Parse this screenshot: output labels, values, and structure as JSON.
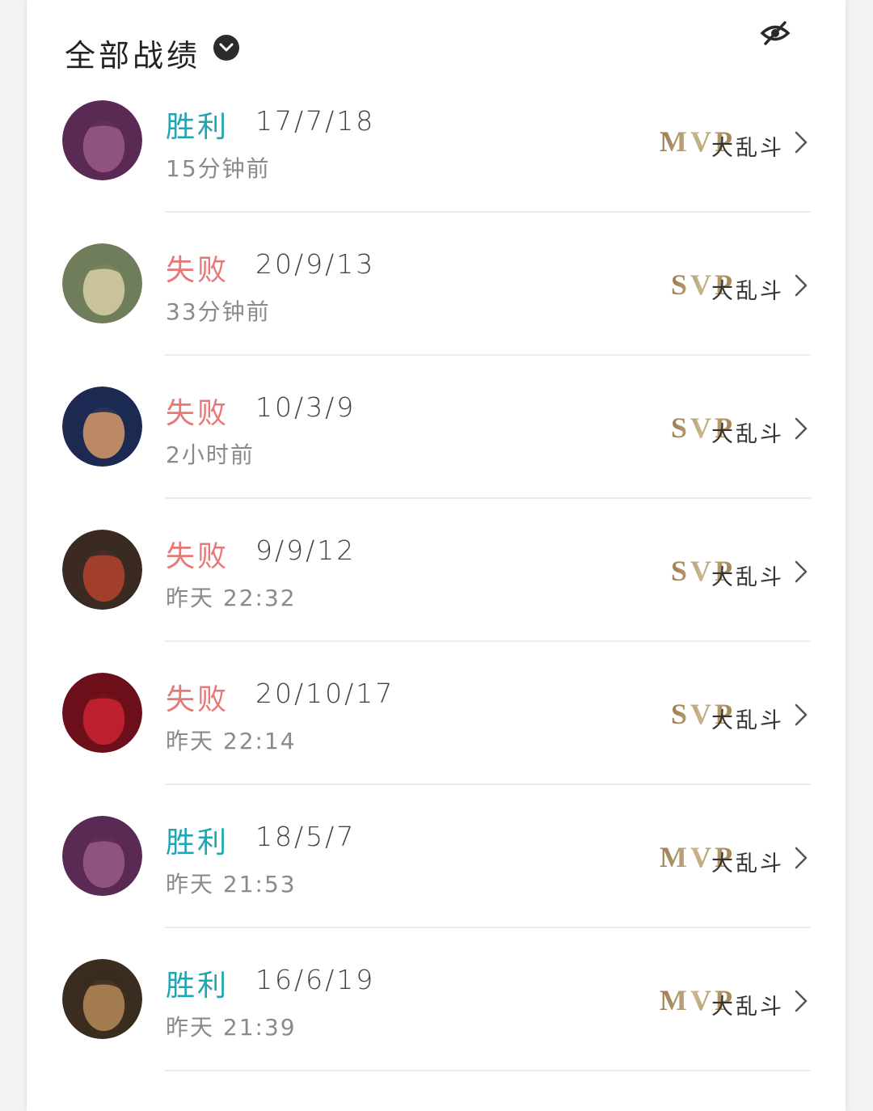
{
  "header": {
    "title": "全部战绩"
  },
  "matches": [
    {
      "result": "胜利",
      "outcome": "win",
      "kda": "17/7/18",
      "time": "15分钟前",
      "badge": "MVP",
      "mode": "大乱斗",
      "avatar_color": "#5a2a55",
      "avatar_accent": "#9a5b86"
    },
    {
      "result": "失败",
      "outcome": "loss",
      "kda": "20/9/13",
      "time": "33分钟前",
      "badge": "SVP",
      "mode": "大乱斗",
      "avatar_color": "#6f7d5a",
      "avatar_accent": "#d9cfa6"
    },
    {
      "result": "失败",
      "outcome": "loss",
      "kda": "10/3/9",
      "time": "2小时前",
      "badge": "SVP",
      "mode": "大乱斗",
      "avatar_color": "#1c2a52",
      "avatar_accent": "#d79a66"
    },
    {
      "result": "失败",
      "outcome": "loss",
      "kda": "9/9/12",
      "time": "昨天 22:32",
      "badge": "SVP",
      "mode": "大乱斗",
      "avatar_color": "#3a2a22",
      "avatar_accent": "#b5432c"
    },
    {
      "result": "失败",
      "outcome": "loss",
      "kda": "20/10/17",
      "time": "昨天 22:14",
      "badge": "SVP",
      "mode": "大乱斗",
      "avatar_color": "#6d0f1a",
      "avatar_accent": "#cc2233"
    },
    {
      "result": "胜利",
      "outcome": "win",
      "kda": "18/5/7",
      "time": "昨天 21:53",
      "badge": "MVP",
      "mode": "大乱斗",
      "avatar_color": "#5a2a55",
      "avatar_accent": "#9a5b86"
    },
    {
      "result": "胜利",
      "outcome": "win",
      "kda": "16/6/19",
      "time": "昨天 21:39",
      "badge": "MVP",
      "mode": "大乱斗",
      "avatar_color": "#3a2c1f",
      "avatar_accent": "#b58a57"
    }
  ],
  "colors": {
    "win": "#1fa6b5",
    "loss": "#e87777",
    "badge_gold": "#a98656"
  }
}
